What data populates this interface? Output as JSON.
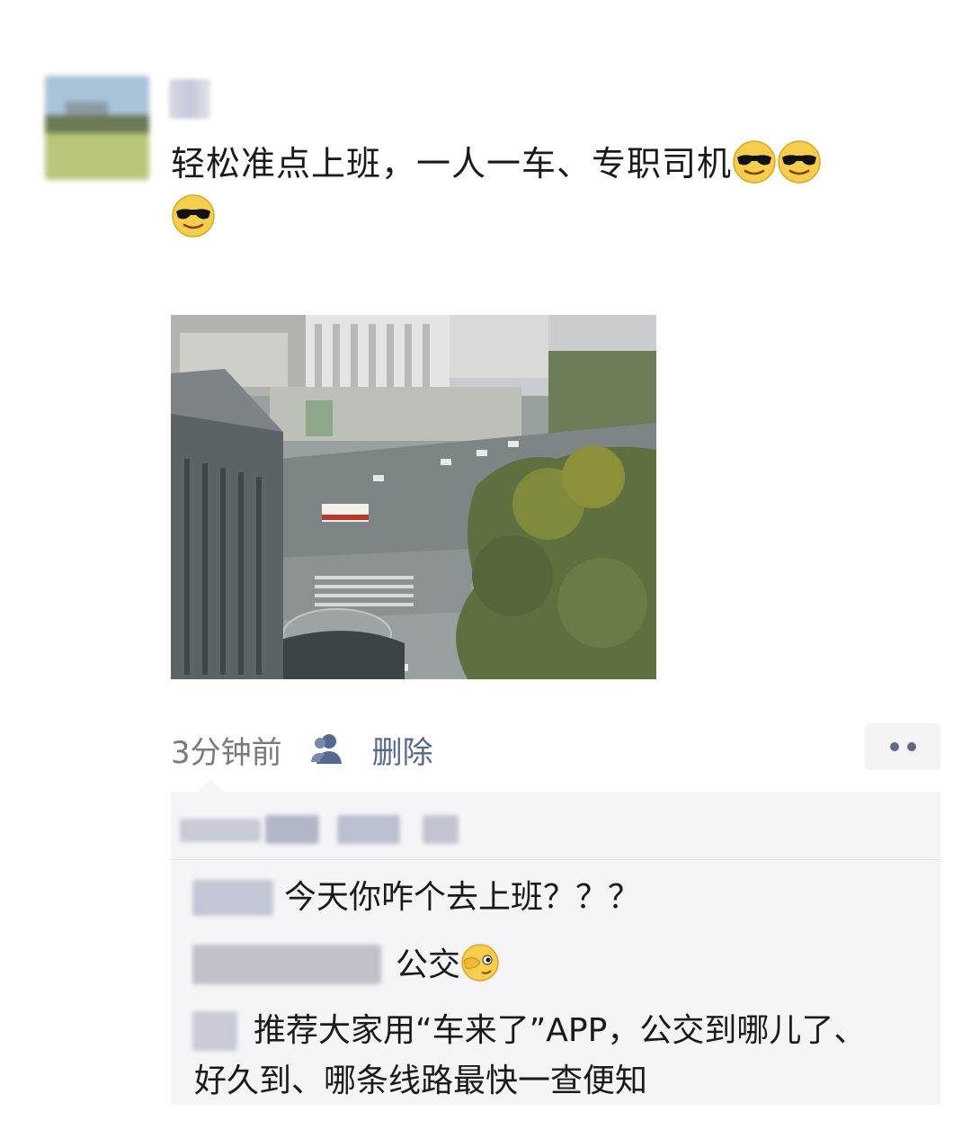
{
  "post": {
    "text": "轻松准点上班，一人一车、专职司机",
    "emojis": [
      "cool-sunglasses-icon",
      "cool-sunglasses-icon",
      "cool-sunglasses-icon"
    ],
    "image_description_icon": "city-street-photo"
  },
  "meta": {
    "time": "3分钟前",
    "visibility_icon": "people-icon",
    "delete_label": "删除",
    "more_icon": "more-dots-icon"
  },
  "comments": [
    {
      "text": "今天你咋个去上班？？？"
    },
    {
      "text": "公交",
      "emoji": "facepalm-peek-icon"
    },
    {
      "text": "推荐大家用“车来了”APP，公交到哪儿了、好久到、哪条线路最快一查便知"
    }
  ],
  "colors": {
    "link": "#55698f",
    "time": "#7a7a7a",
    "comment_bg": "#f5f5f7"
  }
}
